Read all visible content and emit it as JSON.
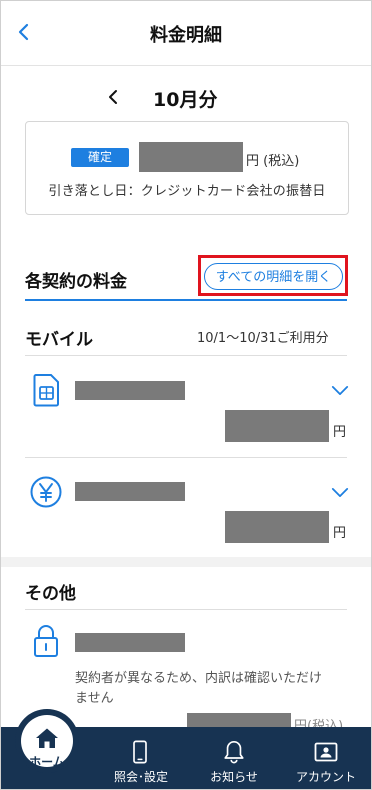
{
  "header": {
    "title": "料金明細"
  },
  "month": {
    "label": "10月分"
  },
  "summary": {
    "badge": "確定",
    "amount_suffix": "円 (税込)",
    "debit_text": "引き落とし日：クレジットカード会社の振替日"
  },
  "contracts": {
    "title": "各契約の料金",
    "open_all_label": "すべての明細を開く"
  },
  "mobile": {
    "title": "モバイル",
    "usage_period": "10/1〜10/31ご利用分",
    "items": [
      {
        "icon": "sim-card-icon",
        "yen": "円"
      },
      {
        "icon": "yen-circle-icon",
        "yen": "円"
      }
    ]
  },
  "other": {
    "title": "その他",
    "items": [
      {
        "icon": "lock-icon",
        "note": "契約者が異なるため、内訳は確認いただけません",
        "yen": "円(税込)"
      }
    ]
  },
  "tabbar": {
    "home": "ホーム",
    "inquiry": "照会･設定",
    "notice": "お知らせ",
    "account": "アカウント"
  },
  "colors": {
    "accent": "#1e7fe0",
    "navy": "#173352",
    "highlight": "#e0141e",
    "redaction": "#7a7a7a"
  }
}
